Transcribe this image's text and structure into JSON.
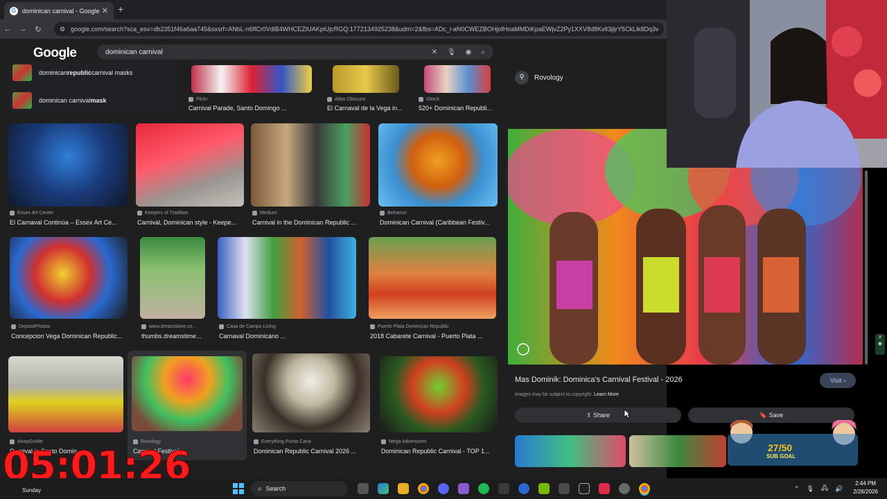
{
  "browser": {
    "tab_title": "dominican carnival - Google Se",
    "tab_close": "✕",
    "new_tab": "+",
    "url": "google.com/search?sca_esv=db2351f46a6aa745&sxsrf=ANbL-n6flCr0VdlB4WHCEZIUAKpiUjcRGQ:1772134925238&udm=2&fbs=ADc_l-aN0CWEZBOHjofHoaMMDiKpaEWjvZ2Py1XXV8d8KvlI3jljrY5CkLlk8Dq3v"
  },
  "google": {
    "logo": "Google",
    "query": "dominican carnival",
    "suggestions": [
      {
        "pre": "dominican ",
        "bold": "republic",
        "post": " carnival masks"
      },
      {
        "pre": "dominican carnival ",
        "bold": "mask",
        "post": ""
      }
    ]
  },
  "results": [
    {
      "src": "Flickr",
      "cap": "Carnival Parade, Santo Domingo ..."
    },
    {
      "src": "Atlas Obscura",
      "cap": "El Carnaval de la Vega in..."
    },
    {
      "src": "iStock",
      "cap": "520+ Dominican Republi..."
    },
    {
      "src": "Essex Art Center",
      "cap": "El Carnaval Continúa – Essex Art Ce..."
    },
    {
      "src": "Keepers of Tradition",
      "cap": "Carnival, Dominican style - Keepe..."
    },
    {
      "src": "Medium",
      "cap": "Carnival in the Dominican Republic ..."
    },
    {
      "src": "Behance",
      "cap": "Dominican Carnival (Caribbean Festiv..."
    },
    {
      "src": "DepositPhotos",
      "cap": "Concepcion Vega Dominican Republic..."
    },
    {
      "src": "www.dreamstime.co...",
      "cap": "thumbs.dreamstime..."
    },
    {
      "src": "Casa de Campo Living",
      "cap": "Carnaval Dominicano ..."
    },
    {
      "src": "Puerto Plata Dominican Republic",
      "cap": "2018 Cabarete Carnival - Puerto Plata ..."
    },
    {
      "src": "AwayGoWe",
      "cap": "Carnival in Santo Domin..."
    },
    {
      "src": "Rovology",
      "cap": "Carnival Festival ..."
    },
    {
      "src": "Everything Punta Cana",
      "cap": "Dominican Republic Carnival 2026 ..."
    },
    {
      "src": "Mega Adventures",
      "cap": "Dominican Republic Carnival - TOP 1..."
    }
  ],
  "panel": {
    "source": "Rovology",
    "title": "Mas Dominik: Dominica's Carnival Festival - 2026",
    "visit": "Visit",
    "copyright": "Images may be subject to copyright.",
    "learn_more": "Learn More",
    "share": "Share",
    "save": "Save"
  },
  "overlay": {
    "timer": "05:01:26",
    "goal": "27/50",
    "goal_label": "SUB GOAL"
  },
  "taskbar": {
    "search": "Search",
    "weather_day": "Sunday",
    "time": "2:44 PM",
    "date": "2/26/2026"
  },
  "colors": {
    "accent": "#a8c7fa",
    "timer": "#ff1b1b",
    "goal": "#ffe94d"
  }
}
